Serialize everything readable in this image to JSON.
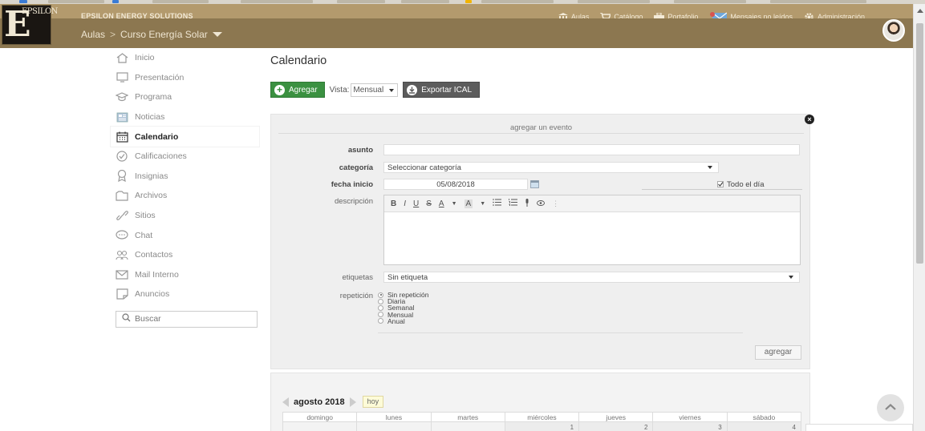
{
  "header": {
    "company": "EPSILON ENERGY SOLUTIONS",
    "logo_text": "EPSILON",
    "nav": [
      {
        "label": "Aulas",
        "icon": "building-icon"
      },
      {
        "label": "Catálogo",
        "icon": "cart-icon"
      },
      {
        "label": "Portafolio",
        "icon": "briefcase-icon"
      },
      {
        "label": "Mensajes no leídos",
        "icon": "mail-icon"
      },
      {
        "label": "Administración",
        "icon": "gear-icon"
      }
    ],
    "breadcrumb": [
      "Aulas",
      "Curso Energía Solar"
    ]
  },
  "sidebar": {
    "items": [
      {
        "label": "Inicio",
        "icon": "home-icon"
      },
      {
        "label": "Presentación",
        "icon": "monitor-icon"
      },
      {
        "label": "Programa",
        "icon": "graduation-cap-icon"
      },
      {
        "label": "Noticias",
        "icon": "newspaper-icon"
      },
      {
        "label": "Calendario",
        "icon": "calendar-icon",
        "active": true
      },
      {
        "label": "Calificaciones",
        "icon": "check-circle-icon"
      },
      {
        "label": "Insignias",
        "icon": "badge-icon"
      },
      {
        "label": "Archivos",
        "icon": "folder-icon"
      },
      {
        "label": "Sitios",
        "icon": "link-icon"
      },
      {
        "label": "Chat",
        "icon": "chat-icon"
      },
      {
        "label": "Contactos",
        "icon": "contacts-icon"
      },
      {
        "label": "Mail Interno",
        "icon": "envelope-icon"
      },
      {
        "label": "Anuncios",
        "icon": "announcement-icon"
      }
    ],
    "search_label": "Buscar"
  },
  "main": {
    "title": "Calendario",
    "add_button": "Agregar",
    "vista_label": "Vista:",
    "vista_value": "Mensual",
    "export_button": "Exportar ICAL"
  },
  "event_form": {
    "heading": "agregar un evento",
    "asunto_label": "asunto",
    "asunto_value": "",
    "categoria_label": "categoría",
    "categoria_value": "Seleccionar categoría",
    "fecha_label": "fecha inicio",
    "fecha_value": "05/08/2018",
    "todo_dia_label": "Todo el día",
    "descripcion_label": "descripción",
    "etiquetas_label": "etiquetas",
    "etiquetas_value": "Sin etiqueta",
    "repeticion_label": "repetición",
    "repeticion_options": [
      "Sin repetición",
      "Diaria",
      "Semanal",
      "Mensual",
      "Anual"
    ],
    "submit_button": "agregar",
    "editor_tools": [
      "B",
      "I",
      "U",
      "S",
      "A",
      "A",
      "list-bullet",
      "list-number",
      "mic",
      "eye",
      "more"
    ]
  },
  "calendar": {
    "month": "agosto 2018",
    "today_button": "hoy",
    "weekdays": [
      "domingo",
      "lunes",
      "martes",
      "miércoles",
      "jueves",
      "viernes",
      "sábado"
    ],
    "first_row_days": [
      "",
      "",
      "",
      "1",
      "2",
      "3",
      "4"
    ]
  },
  "colors": {
    "header_top": "#b39a6d",
    "header_sub": "#8c7750",
    "green_button": "#3b9141",
    "dark_button": "#5c5c5c"
  }
}
